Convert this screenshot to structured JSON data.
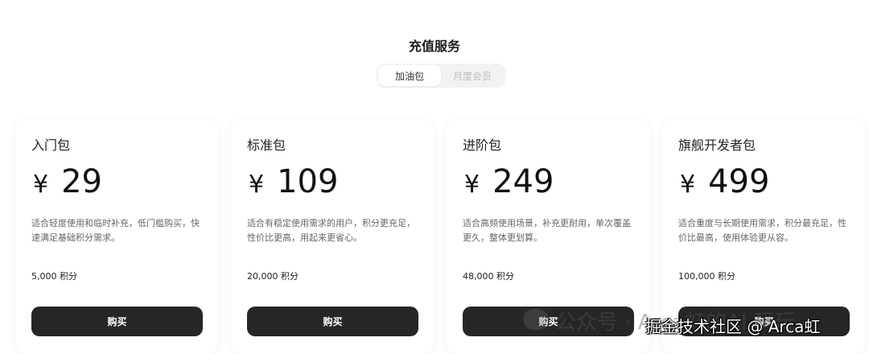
{
  "header": {
    "title": "充值服务"
  },
  "tabs": [
    {
      "label": "加油包",
      "active": true
    },
    {
      "label": "月度会员",
      "active": false
    }
  ],
  "plans": [
    {
      "name": "入门包",
      "currency": "¥",
      "price": "29",
      "description": "适合轻度使用和临时补充，低门槛购买，快速满足基础积分需求。",
      "credits": "5,000 积分",
      "button": "购买"
    },
    {
      "name": "标准包",
      "currency": "¥",
      "price": "109",
      "description": "适合有稳定使用需求的用户，积分更充足，性价比更高，用起来更省心。",
      "credits": "20,000 积分",
      "button": "购买"
    },
    {
      "name": "进阶包",
      "currency": "¥",
      "price": "249",
      "description": "适合高频使用场景，补充更耐用，单次覆盖更久，整体更划算。",
      "credits": "48,000 积分",
      "button": "购买"
    },
    {
      "name": "旗舰开发者包",
      "currency": "¥",
      "price": "499",
      "description": "适合重度与长期使用需求，积分最充足，性价比最高，使用体验更从容。",
      "credits": "100,000 积分",
      "button": "购买"
    }
  ],
  "watermark": {
    "line1": "公众号 · Arca虹的AI 玩玩",
    "line2": "掘金技术社区 @ Arca虹"
  },
  "colors": {
    "button_bg": "#262626",
    "tab_inactive_text": "#bdbdbd",
    "tab_track": "#f2f2f2"
  }
}
